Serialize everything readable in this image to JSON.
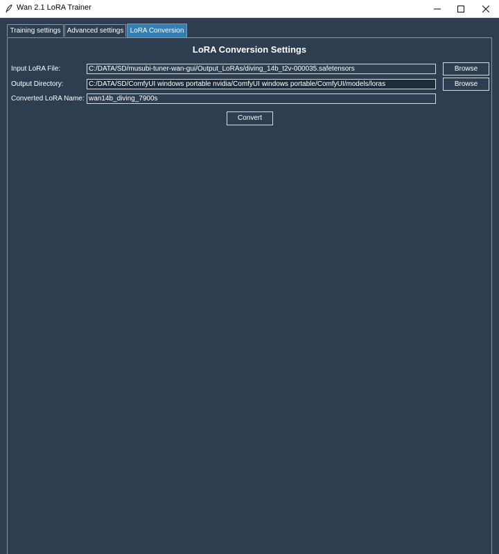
{
  "window": {
    "title": "Wan 2.1 LoRA Trainer"
  },
  "tabs": [
    {
      "label": "Training settings",
      "active": false
    },
    {
      "label": "Advanced settings",
      "active": false
    },
    {
      "label": "LoRA Conversion",
      "active": true
    }
  ],
  "conversion": {
    "heading": "LoRA Conversion Settings",
    "input_label": "Input LoRA File:",
    "input_value": "C:/DATA/SD/musubi-tuner-wan-gui/Output_LoRAs/diving_14b_t2v-000035.safetensors",
    "output_label": "Output Directory:",
    "output_value": "C:/DATA/SD/ComfyUI windows portable nvidia/ComfyUI windows portable/ComfyUI/models/loras",
    "name_label": "Converted LoRA Name:",
    "name_value": "wan14b_diving_7900s",
    "browse_label": "Browse",
    "convert_label": "Convert"
  },
  "colors": {
    "background": "#2c3e50",
    "active_tab": "#2f80b9"
  },
  "icons": {
    "app": "feather-icon",
    "minimize": "minimize-icon",
    "maximize": "maximize-icon",
    "close": "close-icon"
  }
}
